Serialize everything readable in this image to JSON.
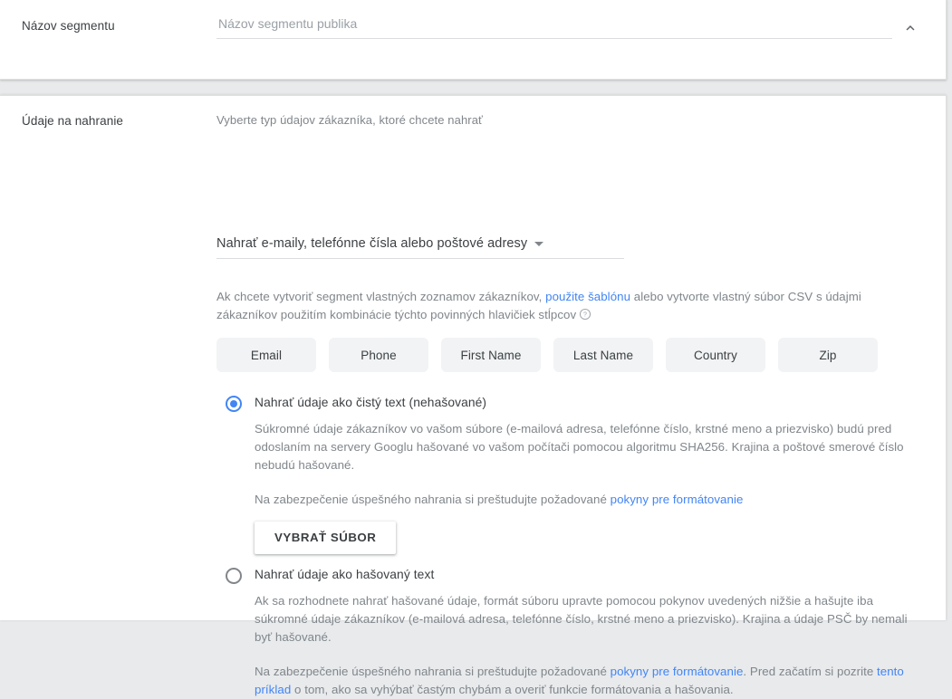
{
  "segment_name_section": {
    "label": "Názov segmentu",
    "input_value": "",
    "input_placeholder": "Názov segmentu publika",
    "collapse_icon": "chevron-up-icon"
  },
  "upload_section": {
    "label": "Údaje na nahranie",
    "hint": "Vyberte typ údajov zákazníka, ktoré chcete nahrať",
    "select": {
      "value": "Nahrať e-maily, telefónne čísla alebo poštové adresy",
      "arrow_icon": "chevron-down-icon"
    },
    "description": {
      "part1": "Ak chcete vytvoriť segment vlastných zoznamov zákazníkov, ",
      "link1": "použite šablónu",
      "part2": " alebo vytvorte vlastný súbor CSV s údajmi zákazníkov použitím kombinácie týchto povinných hlavičiek stĺpcov",
      "help_icon": "help-circle-icon"
    },
    "columns": [
      "Email",
      "Phone",
      "First Name",
      "Last Name",
      "Country",
      "Zip"
    ],
    "options": [
      {
        "selected": true,
        "label": "Nahrať údaje ako čistý text (nehašované)",
        "body": "Súkromné údaje zákazníkov vo vašom súbore (e-mailová adresa, telefónne číslo, krstné meno a priezvisko) budú pred odoslaním na servery Googlu hašované vo vašom počítači pomocou algoritmu SHA256. Krajina a poštové smerové číslo nebudú hašované.",
        "note_part1": "Na zabezpečenie úspešného nahrania si preštudujte požadované ",
        "note_link": "pokyny pre formátovanie",
        "note_part2": "",
        "button_label": "VYBRAŤ SÚBOR"
      },
      {
        "selected": false,
        "label": "Nahrať údaje ako hašovaný text",
        "body": "Ak sa rozhodnete nahrať hašované údaje, formát súboru upravte pomocou pokynov uvedených nižšie a hašujte iba súkromné údaje zákazníkov (e-mailová adresa, telefónne číslo, krstné meno a priezvisko). Krajina a údaje PSČ by nemali byť hašované.",
        "note_part1": "Na zabezpečenie úspešného nahrania si preštudujte požadované ",
        "note_link": "pokyny pre formátovanie",
        "note_part2": ". Pred začatím si pozrite ",
        "note_link2": "tento príklad",
        "note_part3": " o tom, ako sa vyhýbať častým chybám a overiť funkcie formátovania a hašovania."
      }
    ]
  },
  "colors": {
    "accent": "#4285f4",
    "text_primary": "#3c4043",
    "text_secondary": "#80868b",
    "chip_bg": "#f1f3f4",
    "page_bg": "#e9eaeb"
  }
}
